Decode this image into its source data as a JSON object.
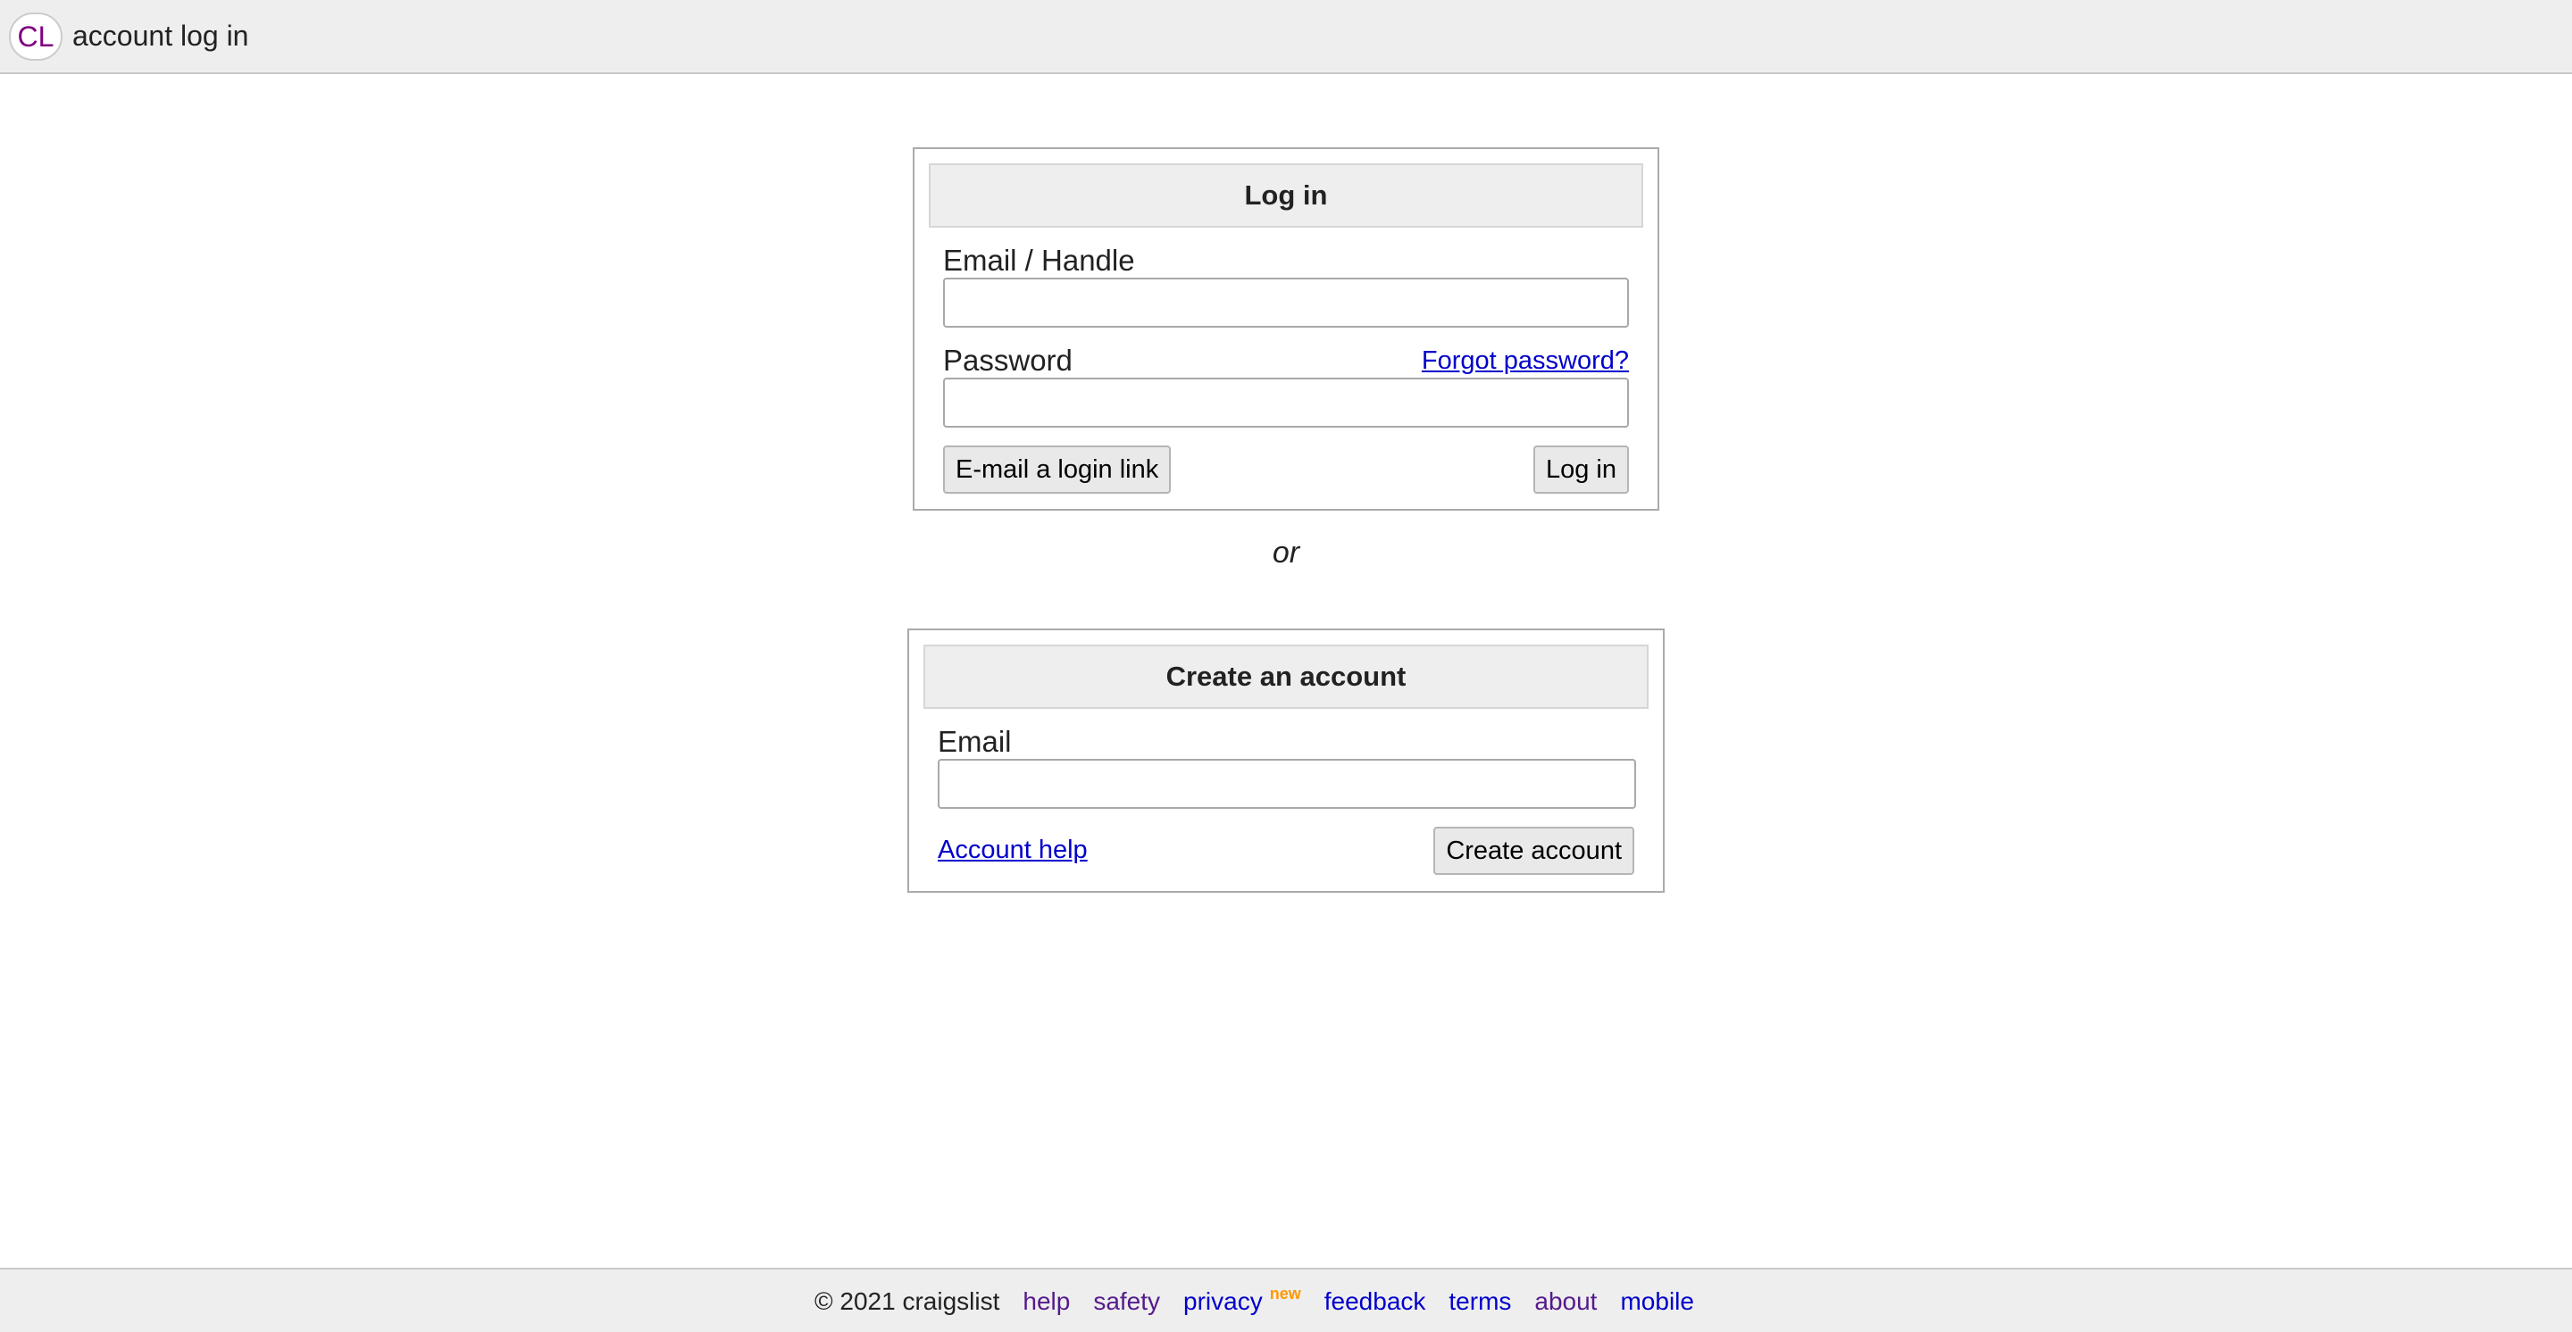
{
  "header": {
    "logo_text": "CL",
    "title": "account log in"
  },
  "login": {
    "heading": "Log in",
    "email_label": "Email / Handle",
    "email_value": "",
    "password_label": "Password",
    "password_value": "",
    "forgot_link": "Forgot password?",
    "email_link_button": "E-mail a login link",
    "login_button": "Log in"
  },
  "separator": "or",
  "create": {
    "heading": "Create an account",
    "email_label": "Email",
    "email_value": "",
    "help_link": "Account help",
    "create_button": "Create account"
  },
  "footer": {
    "copyright": "© 2021 craigslist",
    "links": [
      {
        "label": "help",
        "state": "visited"
      },
      {
        "label": "safety",
        "state": "visited"
      },
      {
        "label": "privacy",
        "state": "unvisited",
        "badge": "new"
      },
      {
        "label": "feedback",
        "state": "unvisited"
      },
      {
        "label": "terms",
        "state": "unvisited"
      },
      {
        "label": "about",
        "state": "visited"
      },
      {
        "label": "mobile",
        "state": "unvisited"
      }
    ],
    "colors": {
      "visited_link": "#551a8b",
      "unvisited_link": "#0000cc",
      "badge": "#ff9900"
    }
  }
}
